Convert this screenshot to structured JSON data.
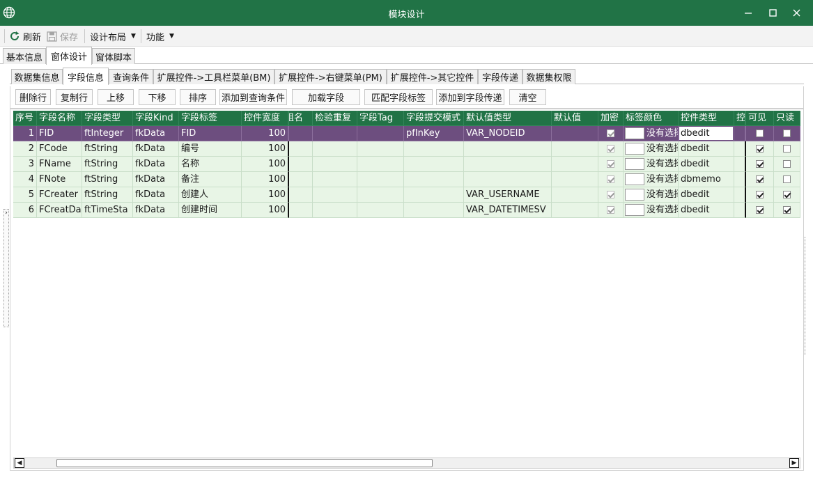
{
  "window": {
    "title": "模块设计",
    "accent": "#217346"
  },
  "toolbar": {
    "refresh_label": "刷新",
    "save_label": "保存",
    "layout_label": "设计布局",
    "function_label": "功能"
  },
  "outer_tabs": [
    "基本信息",
    "窗体设计",
    "窗体脚本"
  ],
  "inner_tabs": [
    "数据集信息",
    "字段信息",
    "查询条件",
    "扩展控件->工具栏菜单(BM)",
    "扩展控件->右键菜单(PM)",
    "扩展控件->其它控件",
    "字段传递",
    "数据集权限"
  ],
  "actions": [
    "删除行",
    "复制行",
    "上移",
    "下移",
    "排序",
    "添加到查询条件",
    "加载字段",
    "匹配字段标签",
    "添加到字段传递",
    "清空"
  ],
  "grid": {
    "headers": [
      "序号",
      "字段名称",
      "字段类型",
      "字段Kind",
      "字段标签",
      "控件宽度",
      "组名",
      "检验重复",
      "字段Tag",
      "字段提交模式",
      "默认值类型",
      "默认值",
      "加密",
      "标签颜色",
      "控件类型",
      "控",
      "可见",
      "只读"
    ],
    "rows": [
      {
        "no": "1",
        "name": "FID",
        "type": "ftInteger",
        "kind": "fkData",
        "label": "FID",
        "width": "100",
        "group": "",
        "check": "",
        "tag": "",
        "submit": "pfInKey",
        "default_type": "VAR_NODEID",
        "default": "",
        "encrypt": true,
        "color_text": "没有选择",
        "control": "dbedit",
        "ctl": "",
        "visible": false,
        "readonly": false
      },
      {
        "no": "2",
        "name": "FCode",
        "type": "ftString",
        "kind": "fkData",
        "label": "编号",
        "width": "100",
        "group": "",
        "check": "",
        "tag": "",
        "submit": "",
        "default_type": "",
        "default": "",
        "encrypt": true,
        "color_text": "没有选择",
        "control": "dbedit",
        "ctl": "",
        "visible": true,
        "readonly": false
      },
      {
        "no": "3",
        "name": "FName",
        "type": "ftString",
        "kind": "fkData",
        "label": "名称",
        "width": "100",
        "group": "",
        "check": "",
        "tag": "",
        "submit": "",
        "default_type": "",
        "default": "",
        "encrypt": true,
        "color_text": "没有选择",
        "control": "dbedit",
        "ctl": "",
        "visible": true,
        "readonly": false
      },
      {
        "no": "4",
        "name": "FNote",
        "type": "ftString",
        "kind": "fkData",
        "label": "备注",
        "width": "100",
        "group": "",
        "check": "",
        "tag": "",
        "submit": "",
        "default_type": "",
        "default": "",
        "encrypt": true,
        "color_text": "没有选择",
        "control": "dbmemo",
        "ctl": "",
        "visible": true,
        "readonly": false
      },
      {
        "no": "5",
        "name": "FCreater",
        "type": "ftString",
        "kind": "fkData",
        "label": "创建人",
        "width": "100",
        "group": "",
        "check": "",
        "tag": "",
        "submit": "",
        "default_type": "VAR_USERNAME",
        "default": "",
        "encrypt": true,
        "color_text": "没有选择",
        "control": "dbedit",
        "ctl": "",
        "visible": true,
        "readonly": true
      },
      {
        "no": "6",
        "name": "FCreatDa",
        "type": "ftTimeSta",
        "kind": "fkData",
        "label": "创建时间",
        "width": "100",
        "group": "",
        "check": "",
        "tag": "",
        "submit": "",
        "default_type": "VAR_DATETIMESV",
        "default": "",
        "encrypt": true,
        "color_text": "没有选择",
        "control": "dbedit",
        "ctl": "",
        "visible": true,
        "readonly": true
      }
    ]
  },
  "colors": {
    "header_bg": "#217346",
    "row_bg": "#e8f5e6",
    "selected_bg": "#6d4e7f"
  }
}
